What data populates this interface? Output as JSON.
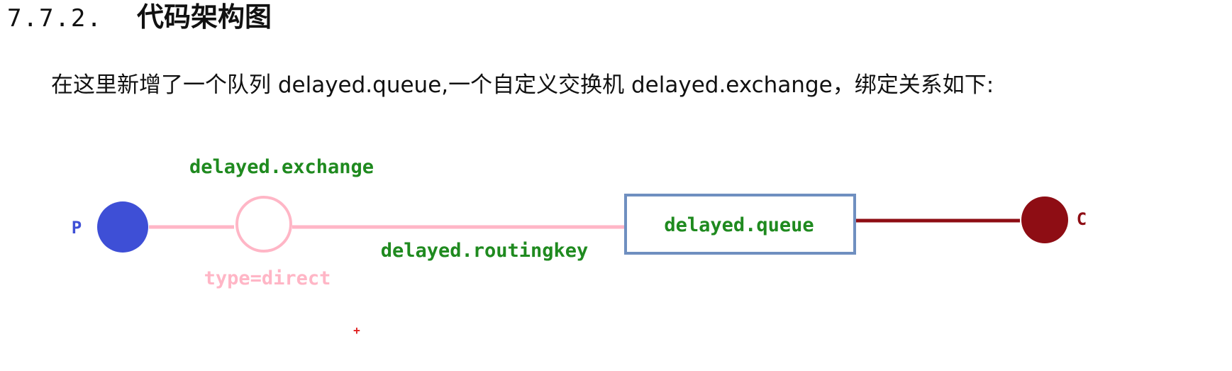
{
  "heading": {
    "number": "7.7.2.",
    "title": "代码架构图"
  },
  "intro": {
    "text": "在这里新增了一个队列 delayed.queue,一个自定义交换机 delayed.exchange，绑定关系如下:"
  },
  "diagram": {
    "producer_label": "P",
    "exchange_name": "delayed.exchange",
    "exchange_type": "type=direct",
    "routing_key": "delayed.routingkey",
    "queue_name": "delayed.queue",
    "consumer_label": "C",
    "stray_mark": "+",
    "colors": {
      "producer": "#3e4fd6",
      "exchange_stroke": "#ffb6c6",
      "pink_line": "#ffb6c6",
      "green_text": "#1f8a1f",
      "queue_border": "#6f8fc0",
      "consumer": "#8e0d14",
      "consumer_line": "#8e0d14",
      "red_mark": "#e02020"
    }
  }
}
